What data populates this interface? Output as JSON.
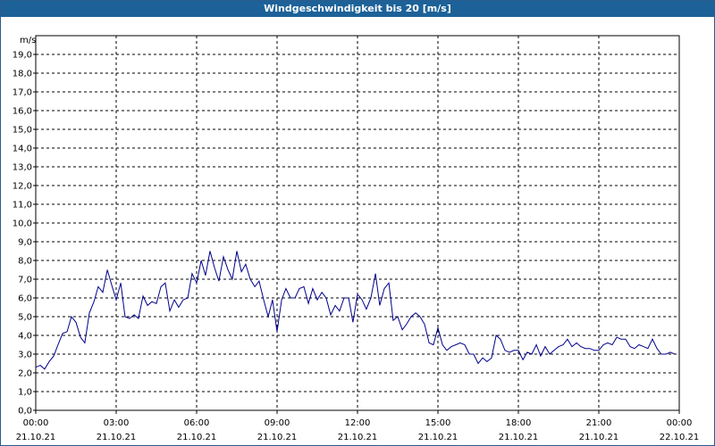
{
  "chart_data": {
    "type": "line",
    "title": "Windgeschwindigkeit bis 20 [m/s]",
    "ylabel": "m/s",
    "ylim": [
      0,
      20
    ],
    "y_ticks": [
      "0,0",
      "1,0",
      "2,0",
      "3,0",
      "4,0",
      "5,0",
      "6,0",
      "7,0",
      "8,0",
      "9,0",
      "10,0",
      "11,0",
      "12,0",
      "13,0",
      "14,0",
      "15,0",
      "16,0",
      "17,0",
      "18,0",
      "19,0"
    ],
    "x_ticks": [
      {
        "time": "00:00",
        "date": "21.10.21",
        "hour": 0
      },
      {
        "time": "03:00",
        "date": "21.10.21",
        "hour": 3
      },
      {
        "time": "06:00",
        "date": "21.10.21",
        "hour": 6
      },
      {
        "time": "09:00",
        "date": "21.10.21",
        "hour": 9
      },
      {
        "time": "12:00",
        "date": "21.10.21",
        "hour": 12
      },
      {
        "time": "15:00",
        "date": "21.10.21",
        "hour": 15
      },
      {
        "time": "18:00",
        "date": "21.10.21",
        "hour": 18
      },
      {
        "time": "21:00",
        "date": "21.10.21",
        "hour": 21
      },
      {
        "time": "00:00",
        "date": "22.10.21",
        "hour": 24
      }
    ],
    "xlim_hours": [
      0,
      24
    ],
    "grid": true,
    "line_color": "#00008b",
    "series": [
      {
        "hours": [
          0,
          0.17,
          0.33,
          0.5,
          0.67,
          0.83,
          1.0,
          1.17,
          1.33,
          1.5,
          1.67,
          1.83,
          2.0,
          2.17,
          2.33,
          2.5,
          2.67,
          2.83,
          3.0,
          3.17,
          3.33,
          3.5,
          3.67,
          3.83,
          4.0,
          4.17,
          4.33,
          4.5,
          4.67,
          4.83,
          5.0,
          5.17,
          5.33,
          5.5,
          5.67,
          5.83,
          6.0,
          6.17,
          6.33,
          6.5,
          6.67,
          6.83,
          7.0,
          7.17,
          7.33,
          7.5,
          7.67,
          7.83,
          8.0,
          8.17,
          8.33,
          8.5,
          8.67,
          8.83,
          9.0,
          9.17,
          9.33,
          9.5,
          9.67,
          9.83,
          10.0,
          10.17,
          10.33,
          10.5,
          10.67,
          10.83,
          11.0,
          11.17,
          11.33,
          11.5,
          11.67,
          11.83,
          12.0,
          12.17,
          12.33,
          12.5,
          12.67,
          12.83,
          13.0,
          13.17,
          13.33,
          13.5,
          13.67,
          13.83,
          14.0,
          14.17,
          14.33,
          14.5,
          14.67,
          14.83,
          15.0,
          15.17,
          15.33,
          15.5,
          15.67,
          15.83,
          16.0,
          16.17,
          16.33,
          16.5,
          16.67,
          16.83,
          17.0,
          17.17,
          17.33,
          17.5,
          17.67,
          17.83,
          18.0,
          18.17,
          18.33,
          18.5,
          18.67,
          18.83,
          19.0,
          19.17,
          19.33,
          19.5,
          19.67,
          19.83,
          20.0,
          20.17,
          20.33,
          20.5,
          20.67,
          20.83,
          21.0,
          21.17,
          21.33,
          21.5,
          21.67,
          21.83,
          22.0,
          22.17,
          22.33,
          22.5,
          22.67,
          22.83,
          23.0,
          23.17,
          23.33,
          23.5,
          23.67,
          23.83
        ],
        "values": [
          2.3,
          2.4,
          2.2,
          2.6,
          2.9,
          3.5,
          4.1,
          4.2,
          5.0,
          4.7,
          3.9,
          3.6,
          5.2,
          5.8,
          6.6,
          6.3,
          7.5,
          6.7,
          5.9,
          6.8,
          5.0,
          4.9,
          5.1,
          4.9,
          6.1,
          5.6,
          5.8,
          5.7,
          6.6,
          6.8,
          5.3,
          5.9,
          5.5,
          5.9,
          6.0,
          7.3,
          6.8,
          8.0,
          7.2,
          8.5,
          7.6,
          6.9,
          8.2,
          7.5,
          7.0,
          8.5,
          7.4,
          7.8,
          7.0,
          6.6,
          6.9,
          5.9,
          5.0,
          5.9,
          4.2,
          5.9,
          6.5,
          6.0,
          6.0,
          6.5,
          6.6,
          5.7,
          6.5,
          5.9,
          6.3,
          6.0,
          5.1,
          5.6,
          5.3,
          6.0,
          6.0,
          4.7,
          6.2,
          5.9,
          5.4,
          6.0,
          7.3,
          5.6,
          6.5,
          6.8,
          4.8,
          5.0,
          4.3,
          4.6,
          5.0,
          5.2,
          5.0,
          4.6,
          3.6,
          3.5,
          4.4,
          3.5,
          3.2,
          3.4,
          3.5,
          3.6,
          3.5,
          3.0,
          3.0,
          2.5,
          2.8,
          2.6,
          2.8,
          4.0,
          3.8,
          3.2,
          3.1,
          3.2,
          3.2,
          2.7,
          3.1,
          3.0,
          3.5,
          2.9,
          3.4,
          3.0,
          3.2,
          3.4,
          3.5,
          3.8,
          3.4,
          3.6,
          3.4,
          3.3,
          3.3,
          3.2,
          3.2,
          3.5,
          3.6,
          3.5,
          3.9,
          3.8,
          3.8,
          3.4,
          3.3,
          3.5,
          3.4,
          3.3,
          3.8,
          3.3,
          3.0,
          3.0,
          3.1,
          3.0
        ]
      }
    ]
  }
}
